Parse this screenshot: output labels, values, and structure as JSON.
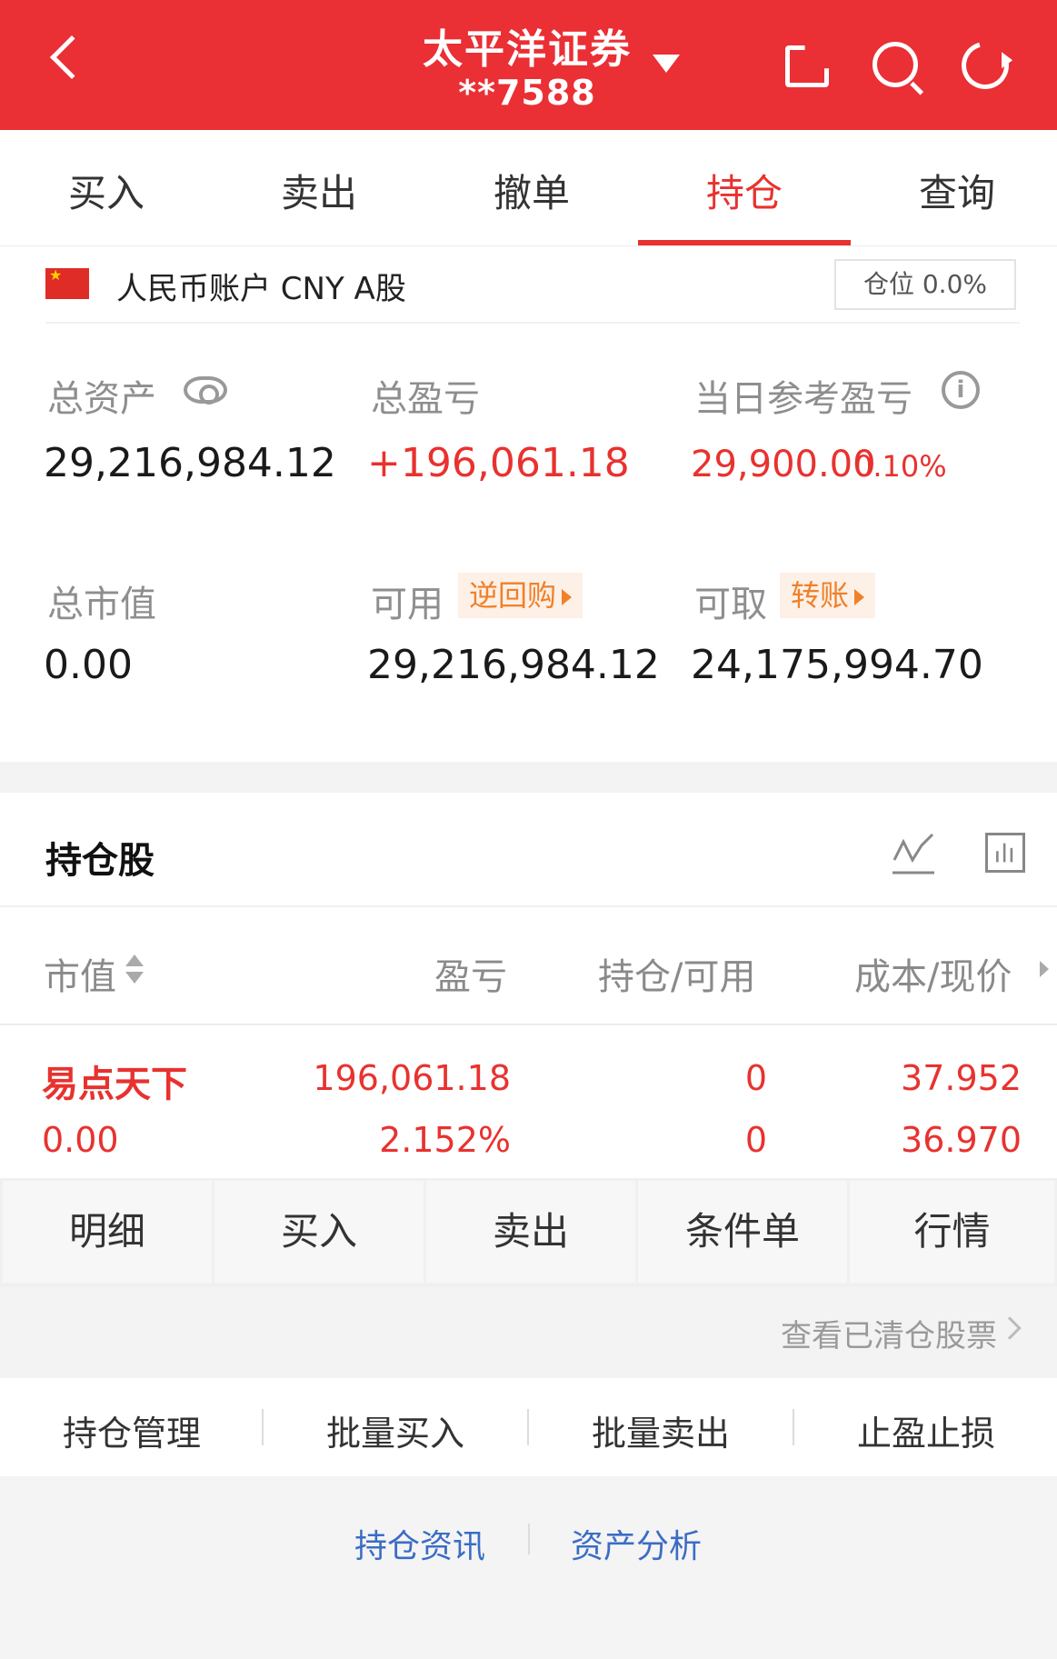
{
  "header": {
    "title": "太平洋证券",
    "account": "**7588"
  },
  "tabs": [
    "买入",
    "卖出",
    "撤单",
    "持仓",
    "查询"
  ],
  "account_row": {
    "label": "人民币账户 CNY A股",
    "position": "仓位 0.0%"
  },
  "summary": {
    "total_assets_label": "总资产",
    "total_assets_value": "29,216,984.12",
    "total_pnl_label": "总盈亏",
    "total_pnl_value": "+196,061.18",
    "daily_pnl_label": "当日参考盈亏",
    "daily_pnl_value": "29,900.00",
    "daily_pnl_pct": "0.10%",
    "market_value_label": "总市值",
    "market_value_value": "0.00",
    "available_label": "可用",
    "available_tag": "逆回购",
    "available_value": "29,216,984.12",
    "withdrawable_label": "可取",
    "withdrawable_tag": "转账",
    "withdrawable_value": "24,175,994.70"
  },
  "holdings": {
    "title": "持仓股",
    "columns": [
      "市值",
      "盈亏",
      "持仓/可用",
      "成本/现价"
    ],
    "rows": [
      {
        "name": "易点天下",
        "market_value": "0.00",
        "pnl": "196,061.18",
        "pnl_pct": "2.152%",
        "position": "0",
        "available": "0",
        "cost": "37.952",
        "price": "36.970"
      }
    ]
  },
  "row_actions": [
    "明细",
    "买入",
    "卖出",
    "条件单",
    "行情"
  ],
  "cleared_link": "查看已清仓股票",
  "tools": [
    "持仓管理",
    "批量买入",
    "批量卖出",
    "止盈止损"
  ],
  "footer_links": [
    "持仓资讯",
    "资产分析"
  ],
  "colors": {
    "brand_red": "#ea2f35",
    "profit_red": "#e8322f",
    "tag_orange": "#f0802a",
    "link_blue": "#3b6dc4"
  }
}
